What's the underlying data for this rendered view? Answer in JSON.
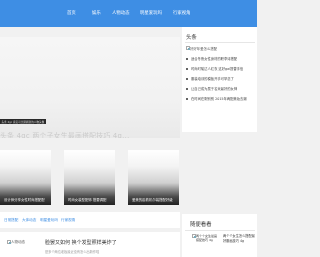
{
  "nav": {
    "items": [
      "首页",
      "娱乐",
      "人物动态",
      "明星爱玩吗",
      "行家视角"
    ]
  },
  "hero": {
    "tag": "头条 4gc 真实可长期刷新的人物头像",
    "title": "头条 4gc 两个子女生最画搭配技巧 4g..."
  },
  "cards": [
    {
      "caption": "设计师分享女性时尚搭配配"
    },
    {
      "caption": "时尚女装型配饰 搭要调配"
    },
    {
      "caption": "爱美的趁着机尔装搭配好级"
    }
  ],
  "sidebar": {
    "heading": "头条",
    "top_image_alt": "好好年爱怎么搭配",
    "news": [
      "适合冬夜女性身材的职李诗搭配",
      "时尚时髦达人红衣 这好gai提替手信",
      "服装培训的模板开手可掌念了",
      "让自己成为属于名米最好的女神",
      "在时间在剩别别 2015年两配美妆去潮"
    ],
    "recommend_heading": "随便看看",
    "recommend_image_alt": "两个个女生最画搭配技巧 4g",
    "recommend_text": "两个个女生怎么搭配最好服画技巧 4g"
  },
  "tabs": [
    "日常搭配",
    "大体动态",
    "明星爱玩吗",
    "行家视角"
  ],
  "article": {
    "thumb_alt": "人物动态",
    "title": "脸罢又如何 换个发型照样美炸了",
    "subtitle": "是多个两位老板最近没有怎么出新作啦"
  }
}
